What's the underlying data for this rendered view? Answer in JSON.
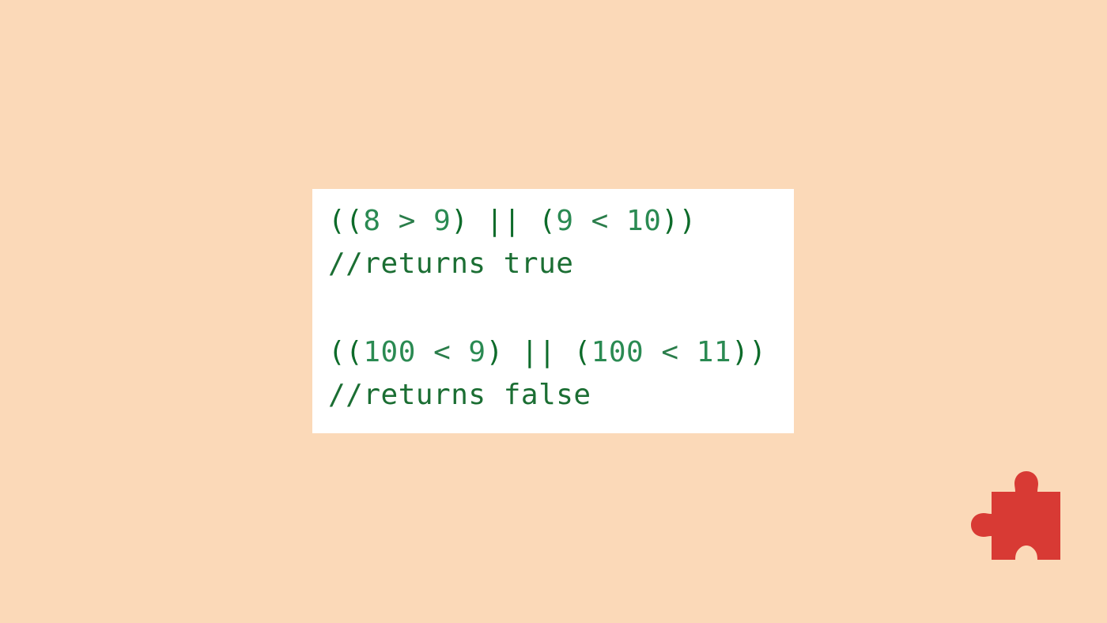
{
  "colors": {
    "background": "#fbd9b8",
    "card": "#ffffff",
    "paren": "#0d6b2a",
    "number": "#2a8a52",
    "operator": "#2a7d4a",
    "comment": "#1b6e33",
    "puzzle": "#d83a34"
  },
  "code": {
    "lines": [
      {
        "tokens": [
          {
            "text": "((",
            "kind": "paren"
          },
          {
            "text": "8",
            "kind": "number"
          },
          {
            "text": " > ",
            "kind": "operator"
          },
          {
            "text": "9",
            "kind": "number"
          },
          {
            "text": ") || (",
            "kind": "paren"
          },
          {
            "text": "9",
            "kind": "number"
          },
          {
            "text": " < ",
            "kind": "operator"
          },
          {
            "text": "10",
            "kind": "number"
          },
          {
            "text": "))",
            "kind": "paren"
          }
        ]
      },
      {
        "tokens": [
          {
            "text": "//returns true",
            "kind": "comment"
          }
        ]
      },
      {
        "tokens": []
      },
      {
        "tokens": [
          {
            "text": "((",
            "kind": "paren"
          },
          {
            "text": "100",
            "kind": "number"
          },
          {
            "text": " < ",
            "kind": "operator"
          },
          {
            "text": "9",
            "kind": "number"
          },
          {
            "text": ") || (",
            "kind": "paren"
          },
          {
            "text": "100",
            "kind": "number"
          },
          {
            "text": " < ",
            "kind": "operator"
          },
          {
            "text": "11",
            "kind": "number"
          },
          {
            "text": "))",
            "kind": "paren"
          }
        ]
      },
      {
        "tokens": [
          {
            "text": "//returns false",
            "kind": "comment"
          }
        ]
      }
    ]
  },
  "logo": {
    "icon": "puzzle-piece-icon"
  }
}
